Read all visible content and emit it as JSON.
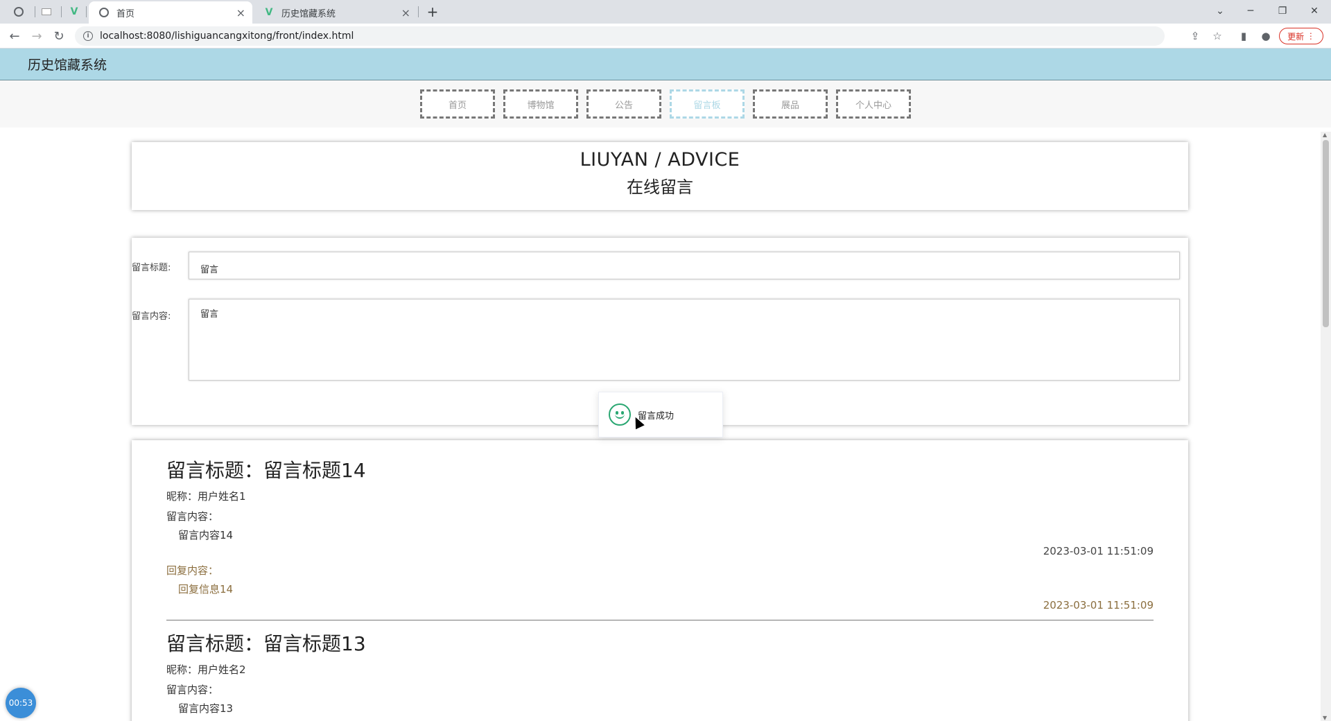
{
  "browser": {
    "tabs": [
      {
        "title": "首页",
        "active": true
      },
      {
        "title": "历史馆藏系统",
        "active": false
      }
    ],
    "url": "localhost:8080/lishiguancangxitong/front/index.html",
    "update_label": "更新"
  },
  "site": {
    "name": "历史馆藏系统",
    "nav": [
      "首页",
      "博物馆",
      "公告",
      "留言板",
      "展品",
      "个人中心"
    ],
    "active_nav": "留言板"
  },
  "section": {
    "title_en": "LIUYAN / ADVICE",
    "title_cn": "在线留言"
  },
  "form": {
    "title_label": "留言标题:",
    "title_value": "留言",
    "content_label": "留言内容:",
    "content_value": "留言"
  },
  "toast": {
    "message": "留言成功"
  },
  "messages": [
    {
      "title": "留言标题：留言标题14",
      "nickname": "昵称：用户姓名1",
      "content_label": "留言内容：",
      "content": "留言内容14",
      "time": "2023-03-01 11:51:09",
      "reply_label": "回复内容：",
      "reply": "回复信息14",
      "reply_time": "2023-03-01 11:51:09"
    },
    {
      "title": "留言标题：留言标题13",
      "nickname": "昵称：用户姓名2",
      "content_label": "留言内容：",
      "content": "留言内容13"
    }
  ],
  "timer": "00:53",
  "colors": {
    "header_bg": "#add8e6",
    "success": "#2aa772",
    "reply": "#8b6e3e"
  }
}
